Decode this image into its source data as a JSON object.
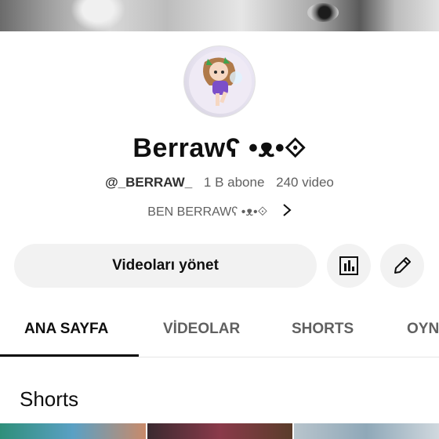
{
  "channel": {
    "name": "Berrawʕ •ᴥ•⟐",
    "handle": "@_BERRAW_",
    "subscribers": "1 B abone",
    "videos": "240 video",
    "description": "BEN BERRAWʕ •ᴥ•⟐"
  },
  "actions": {
    "manage_label": "Videoları yönet",
    "analytics_icon": "bar-chart-icon",
    "edit_icon": "pencil-icon"
  },
  "tabs": [
    {
      "label": "ANA SAYFA",
      "active": true
    },
    {
      "label": "VİDEOLAR",
      "active": false
    },
    {
      "label": "SHORTS",
      "active": false
    },
    {
      "label": "OYN",
      "active": false
    }
  ],
  "sections": {
    "shorts_title": "Shorts"
  },
  "colors": {
    "text_primary": "#0f0f0f",
    "text_secondary": "#606060",
    "button_bg": "#f2f2f2"
  }
}
